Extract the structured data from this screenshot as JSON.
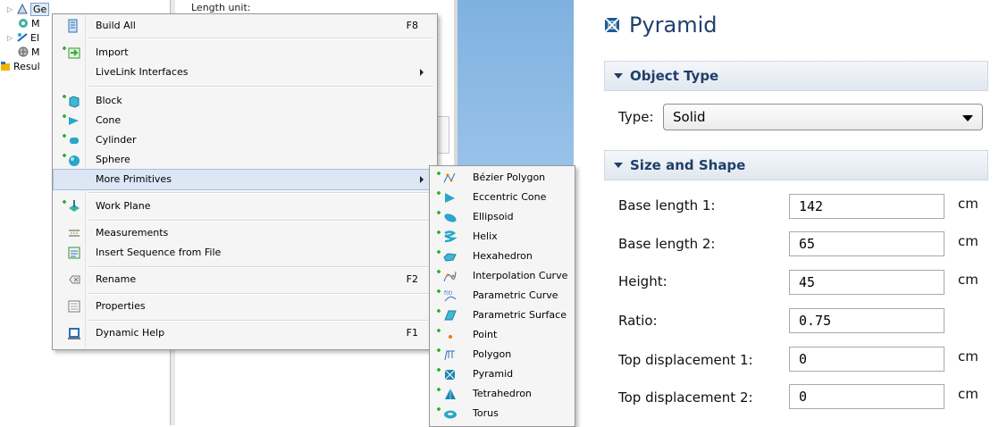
{
  "tree": {
    "items": [
      {
        "label": "Ge",
        "icon": "geometry-icon",
        "expander": "▷"
      },
      {
        "label": "M",
        "icon": "materials-icon",
        "expander": ""
      },
      {
        "label": "El",
        "icon": "electrostatics-icon",
        "expander": "▷"
      },
      {
        "label": "M",
        "icon": "mesh-icon",
        "expander": ""
      },
      {
        "label": "Resul",
        "icon": "results-icon",
        "expander": ""
      }
    ]
  },
  "background_settings": {
    "length_unit_label": "Length unit:"
  },
  "context_menu": {
    "items": [
      {
        "label": "Build All",
        "shortcut": "F8",
        "icon": "build-all-icon"
      },
      {
        "label": "Import",
        "shortcut": "",
        "icon": "import-icon"
      },
      {
        "label": "LiveLink Interfaces",
        "shortcut": "",
        "icon": "",
        "submenu": true
      },
      {
        "label": "Block",
        "shortcut": "",
        "icon": "block-icon"
      },
      {
        "label": "Cone",
        "shortcut": "",
        "icon": "cone-icon"
      },
      {
        "label": "Cylinder",
        "shortcut": "",
        "icon": "cylinder-icon"
      },
      {
        "label": "Sphere",
        "shortcut": "",
        "icon": "sphere-icon"
      },
      {
        "label": "More Primitives",
        "shortcut": "",
        "icon": "",
        "submenu": true
      },
      {
        "label": "Work Plane",
        "shortcut": "",
        "icon": "work-plane-icon"
      },
      {
        "label": "Measurements",
        "shortcut": "",
        "icon": "measurements-icon"
      },
      {
        "label": "Insert Sequence from File",
        "shortcut": "",
        "icon": "insert-sequence-icon"
      },
      {
        "label": "Rename",
        "shortcut": "F2",
        "icon": "rename-icon"
      },
      {
        "label": "Properties",
        "shortcut": "",
        "icon": "properties-icon"
      },
      {
        "label": "Dynamic Help",
        "shortcut": "F1",
        "icon": "dynamic-help-icon"
      }
    ]
  },
  "submenu": {
    "items": [
      {
        "label": "Bézier Polygon",
        "icon": "bezier-polygon-icon"
      },
      {
        "label": "Eccentric Cone",
        "icon": "eccentric-cone-icon"
      },
      {
        "label": "Ellipsoid",
        "icon": "ellipsoid-icon"
      },
      {
        "label": "Helix",
        "icon": "helix-icon"
      },
      {
        "label": "Hexahedron",
        "icon": "hexahedron-icon"
      },
      {
        "label": "Interpolation Curve",
        "icon": "interpolation-curve-icon"
      },
      {
        "label": "Parametric Curve",
        "icon": "parametric-curve-icon"
      },
      {
        "label": "Parametric Surface",
        "icon": "parametric-surface-icon"
      },
      {
        "label": "Point",
        "icon": "point-icon"
      },
      {
        "label": "Polygon",
        "icon": "polygon-icon"
      },
      {
        "label": "Pyramid",
        "icon": "pyramid-icon"
      },
      {
        "label": "Tetrahedron",
        "icon": "tetrahedron-icon"
      },
      {
        "label": "Torus",
        "icon": "torus-icon"
      }
    ]
  },
  "pyramid_panel": {
    "title": "Pyramid",
    "object_type_header": "Object Type",
    "type_label": "Type:",
    "type_value": "Solid",
    "size_shape_header": "Size and Shape",
    "fields": [
      {
        "label": "Base length 1:",
        "value": "142",
        "unit": "cm"
      },
      {
        "label": "Base length 2:",
        "value": "65",
        "unit": "cm"
      },
      {
        "label": "Height:",
        "value": "45",
        "unit": "cm"
      },
      {
        "label": "Ratio:",
        "value": "0.75",
        "unit": ""
      },
      {
        "label": "Top displacement 1:",
        "value": "0",
        "unit": "cm"
      },
      {
        "label": "Top displacement 2:",
        "value": "0",
        "unit": "cm"
      }
    ]
  },
  "colors": {
    "menu_bg": "#f5f5f5",
    "highlight": "#dce6f4",
    "panel_header_text": "#1f3f6a",
    "graphics_blue": "#9cc4ea",
    "plus_green": "#2eb82e"
  }
}
